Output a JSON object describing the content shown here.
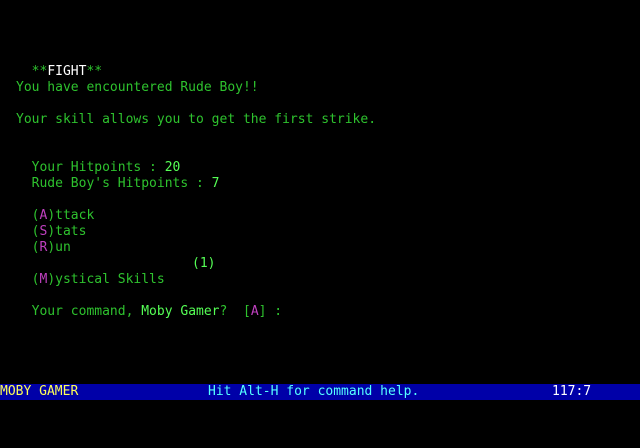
{
  "fight": {
    "stars_left": "**",
    "title": "FIGHT",
    "stars_right": "**",
    "encounter_text": "You have encountered Rude Boy!!",
    "first_strike_text": "Your skill allows you to get the first strike.",
    "your_hp_label": "Your Hitpoints : ",
    "your_hp_value": "20",
    "enemy_hp_label": "Rude Boy's Hitpoints : ",
    "enemy_hp_value": "7"
  },
  "menu": {
    "attack": {
      "open": "(",
      "key": "A",
      "close": ")",
      "rest": "ttack"
    },
    "stats": {
      "open": "(",
      "key": "S",
      "close": ")",
      "rest": "tats"
    },
    "run": {
      "open": "(",
      "key": "R",
      "close": ")",
      "rest": "un"
    },
    "mystical": {
      "open": "(",
      "key": "M",
      "close": ")",
      "rest": "ystical Skills",
      "count": "(1)"
    }
  },
  "prompt": {
    "prefix": "Your command, ",
    "player_name": "Moby Gamer",
    "suffix": "?  ",
    "default_open": "[",
    "default_key": "A",
    "default_close": "]",
    "colon": " :"
  },
  "status_bar": {
    "player_name": "MOBY GAMER",
    "help_text": "Hit Alt-H for command help.",
    "time": "117:7"
  },
  "colors": {
    "text_green": "#2ec22e",
    "bright_green": "#55ff55",
    "key_magenta": "#c040c0",
    "status_bg": "#0000a8",
    "status_name": "#ffff55",
    "status_help": "#55ffff"
  }
}
